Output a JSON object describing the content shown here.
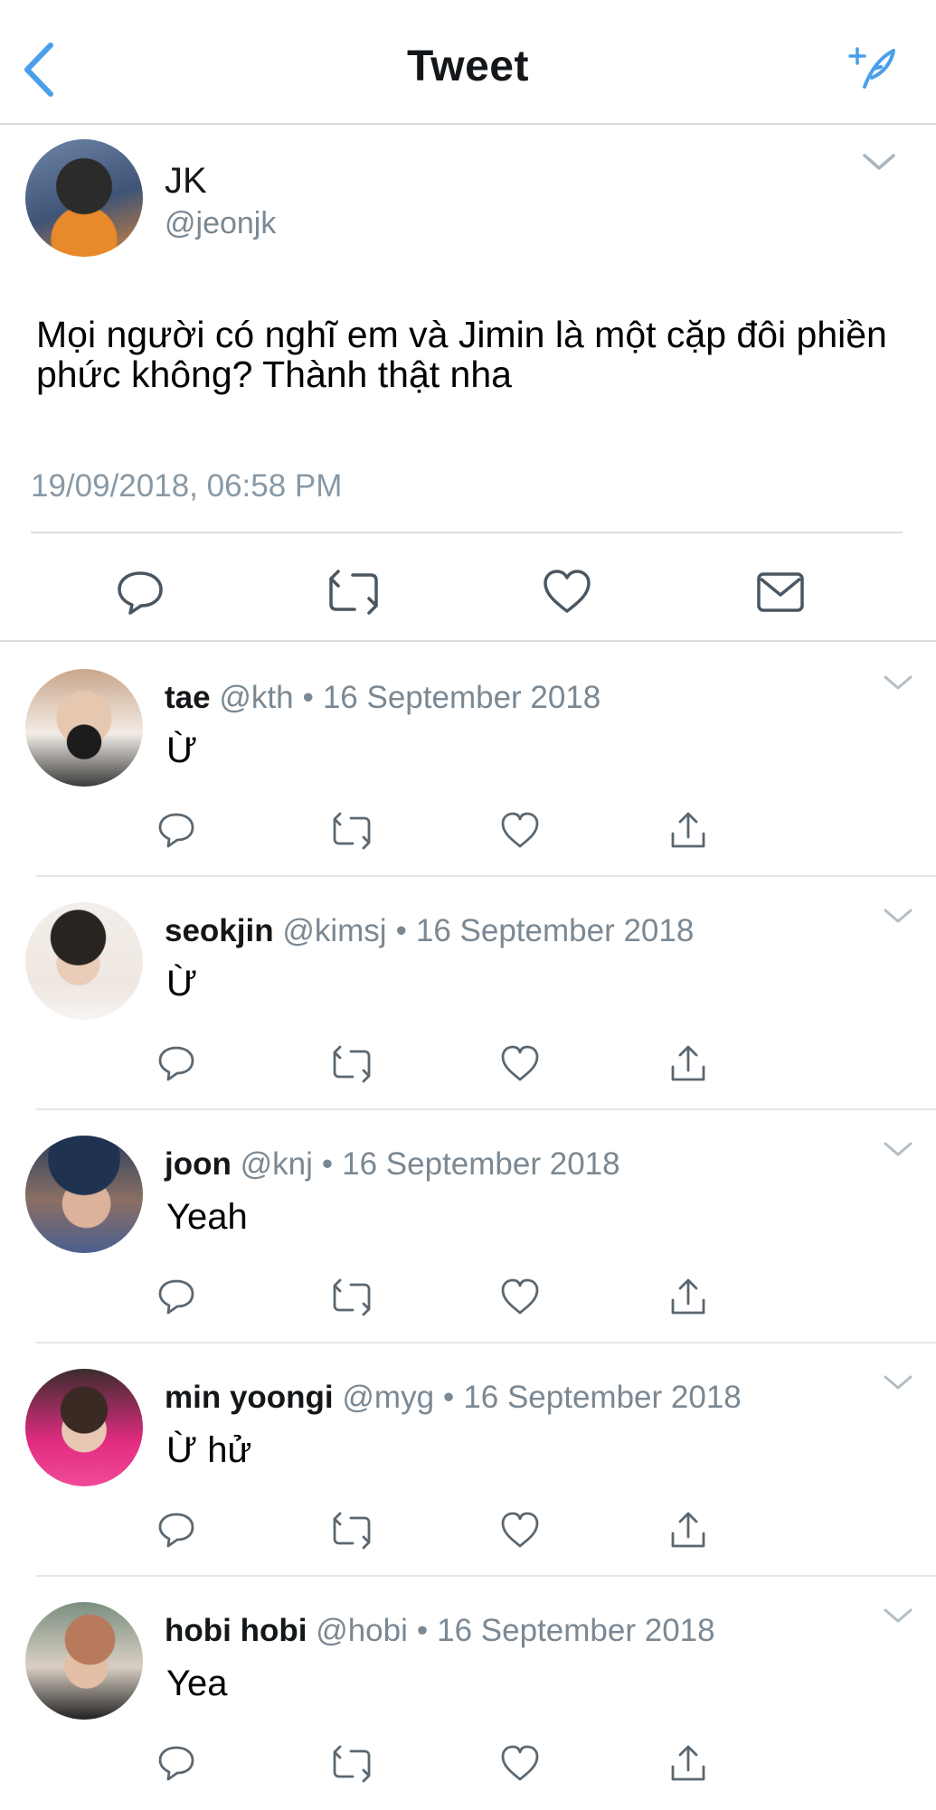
{
  "header": {
    "title": "Tweet",
    "back_icon": "chevron-left-icon",
    "compose_icon": "compose-feather-icon",
    "accent_color": "#4a9fea"
  },
  "main_tweet": {
    "name": "JK",
    "handle": "@jeonjk",
    "text": "Mọi người có nghĩ em và Jimin là một cặp đôi phiền phức không? Thành thật nha",
    "timestamp": "19/09/2018, 06:58 PM",
    "actions": [
      "reply-icon",
      "retweet-icon",
      "like-icon",
      "message-icon"
    ]
  },
  "replies": [
    {
      "name": "tae",
      "handle": "@kth",
      "date": "16 September 2018",
      "text": "Ừ"
    },
    {
      "name": "seokjin",
      "handle": "@kimsj",
      "date": "16 September 2018",
      "text": "Ừ"
    },
    {
      "name": "joon",
      "handle": "@knj",
      "date": "16 September 2018",
      "text": "Yeah"
    },
    {
      "name": "min yoongi",
      "handle": "@myg",
      "date": "16 September 2018",
      "text": "Ừ hử"
    },
    {
      "name": "hobi hobi",
      "handle": "@hobi",
      "date": "16 September 2018",
      "text": "Yea"
    }
  ],
  "separator": "•"
}
